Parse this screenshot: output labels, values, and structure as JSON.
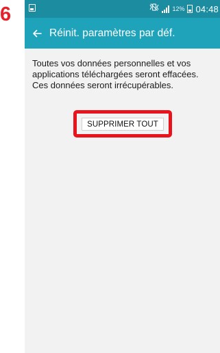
{
  "step": {
    "number": "6",
    "color": "#e8202a"
  },
  "status_bar": {
    "background": "#1c8ca1",
    "left_icon": "gallery-notification-icon",
    "mute_icon": "vibrate-mute-icon",
    "signal_icon": "signal-bars-icon",
    "battery_percent": "12%",
    "battery_icon": "battery-icon",
    "time": "04:48"
  },
  "app_bar": {
    "background": "#1fa3bb",
    "back_icon": "back-arrow-icon",
    "title": "Réinit. paramètres par déf."
  },
  "content": {
    "description": "Toutes vos données personnelles et vos applications téléchargées seront effacées. Ces données seront irrécupérables.",
    "reset_button_label": "SUPPRIMER TOUT",
    "highlight_color": "#e8131b"
  }
}
